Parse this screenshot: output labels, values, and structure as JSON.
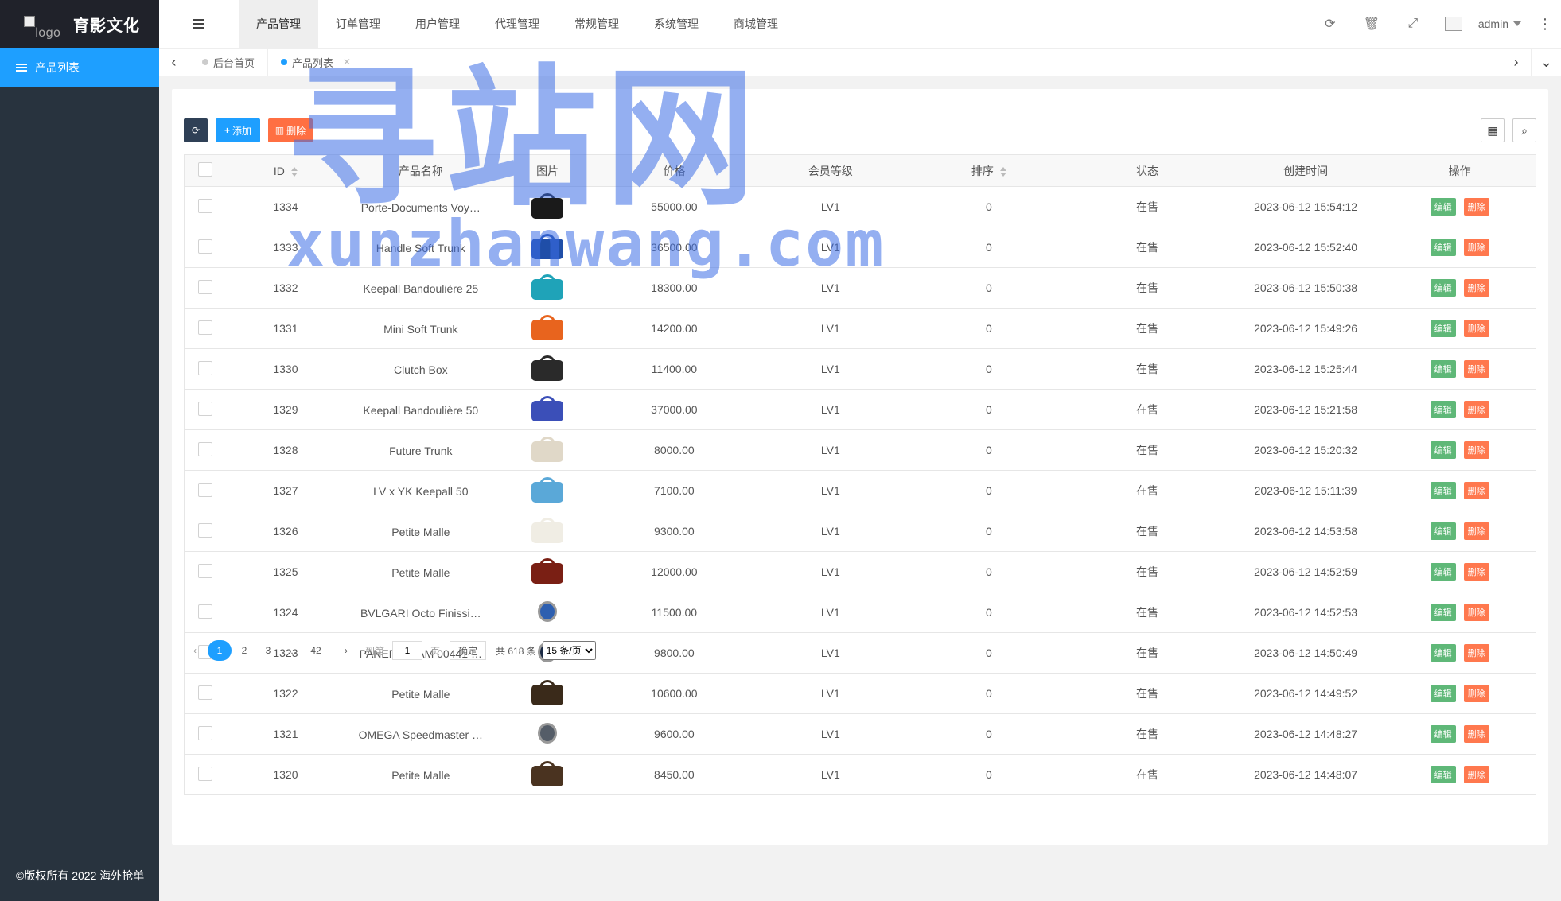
{
  "sidebar": {
    "logo_alt": "logo",
    "brand": "育影文化",
    "menu": [
      {
        "label": "产品列表"
      }
    ],
    "copyright": "©版权所有 2022 海外抢单"
  },
  "header": {
    "nav": [
      "产品管理",
      "订单管理",
      "用户管理",
      "代理管理",
      "常规管理",
      "系统管理",
      "商城管理"
    ],
    "active_nav": 0,
    "user": "admin"
  },
  "tabs": [
    {
      "label": "后台首页",
      "active": false
    },
    {
      "label": "产品列表",
      "active": true
    }
  ],
  "toolbar": {
    "add_label": "添加",
    "delete_label": "删除"
  },
  "table": {
    "columns": [
      "ID",
      "产品名称",
      "图片",
      "价格",
      "会员等级",
      "排序",
      "状态",
      "创建时间",
      "操作"
    ],
    "edit_label": "编辑",
    "delete_label": "删除",
    "rows": [
      {
        "id": "1334",
        "name": "Porte-Documents Voy…",
        "price": "55000.00",
        "level": "LV1",
        "sort": "0",
        "status": "在售",
        "created": "2023-06-12 15:54:12",
        "img": "#1a1a1a"
      },
      {
        "id": "1333",
        "name": "Handle Soft Trunk",
        "price": "36500.00",
        "level": "LV1",
        "sort": "0",
        "status": "在售",
        "created": "2023-06-12 15:52:40",
        "img": "#1f4ea8"
      },
      {
        "id": "1332",
        "name": "Keepall Bandoulière 25",
        "price": "18300.00",
        "level": "LV1",
        "sort": "0",
        "status": "在售",
        "created": "2023-06-12 15:50:38",
        "img": "#1fa3b8"
      },
      {
        "id": "1331",
        "name": "Mini Soft Trunk",
        "price": "14200.00",
        "level": "LV1",
        "sort": "0",
        "status": "在售",
        "created": "2023-06-12 15:49:26",
        "img": "#e8641e"
      },
      {
        "id": "1330",
        "name": "Clutch Box",
        "price": "11400.00",
        "level": "LV1",
        "sort": "0",
        "status": "在售",
        "created": "2023-06-12 15:25:44",
        "img": "#2a2a2a"
      },
      {
        "id": "1329",
        "name": "Keepall Bandoulière 50",
        "price": "37000.00",
        "level": "LV1",
        "sort": "0",
        "status": "在售",
        "created": "2023-06-12 15:21:58",
        "img": "#3b4fb8"
      },
      {
        "id": "1328",
        "name": "Future Trunk",
        "price": "8000.00",
        "level": "LV1",
        "sort": "0",
        "status": "在售",
        "created": "2023-06-12 15:20:32",
        "img": "#e0d8c8"
      },
      {
        "id": "1327",
        "name": "LV x YK Keepall 50",
        "price": "7100.00",
        "level": "LV1",
        "sort": "0",
        "status": "在售",
        "created": "2023-06-12 15:11:39",
        "img": "#5aa8d8"
      },
      {
        "id": "1326",
        "name": "Petite Malle",
        "price": "9300.00",
        "level": "LV1",
        "sort": "0",
        "status": "在售",
        "created": "2023-06-12 14:53:58",
        "img": "#f0ede4"
      },
      {
        "id": "1325",
        "name": "Petite Malle",
        "price": "12000.00",
        "level": "LV1",
        "sort": "0",
        "status": "在售",
        "created": "2023-06-12 14:52:59",
        "img": "#7a1f14"
      },
      {
        "id": "1324",
        "name": "BVLGARI Octo Finissi…",
        "price": "11500.00",
        "level": "LV1",
        "sort": "0",
        "status": "在售",
        "created": "2023-06-12 14:52:53",
        "img": "#2d5fb0",
        "watch": true
      },
      {
        "id": "1323",
        "name": "PANERAI PAM 00441 …",
        "price": "9800.00",
        "level": "LV1",
        "sort": "0",
        "status": "在售",
        "created": "2023-06-12 14:50:49",
        "img": "#1a2a44",
        "watch": true
      },
      {
        "id": "1322",
        "name": "Petite Malle",
        "price": "10600.00",
        "level": "LV1",
        "sort": "0",
        "status": "在售",
        "created": "2023-06-12 14:49:52",
        "img": "#3a2a1a"
      },
      {
        "id": "1321",
        "name": "OMEGA Speedmaster …",
        "price": "9600.00",
        "level": "LV1",
        "sort": "0",
        "status": "在售",
        "created": "2023-06-12 14:48:27",
        "img": "#555d68",
        "watch": true
      },
      {
        "id": "1320",
        "name": "Petite Malle",
        "price": "8450.00",
        "level": "LV1",
        "sort": "0",
        "status": "在售",
        "created": "2023-06-12 14:48:07",
        "img": "#4a3320"
      }
    ]
  },
  "pager": {
    "pages": [
      "1",
      "2",
      "3",
      "…",
      "42"
    ],
    "current": "1",
    "goto_label": "到第",
    "goto_value": "1",
    "page_unit": "页",
    "confirm": "确定",
    "total": "共 618 条",
    "per_page": "15 条/页"
  },
  "watermark": {
    "cn": "寻站网",
    "en": "xunzhanwang.com"
  },
  "colors": {
    "accent": "#1e9fff",
    "sidebar": "#28333e",
    "edit": "#5fb878",
    "danger": "#ff5722"
  }
}
